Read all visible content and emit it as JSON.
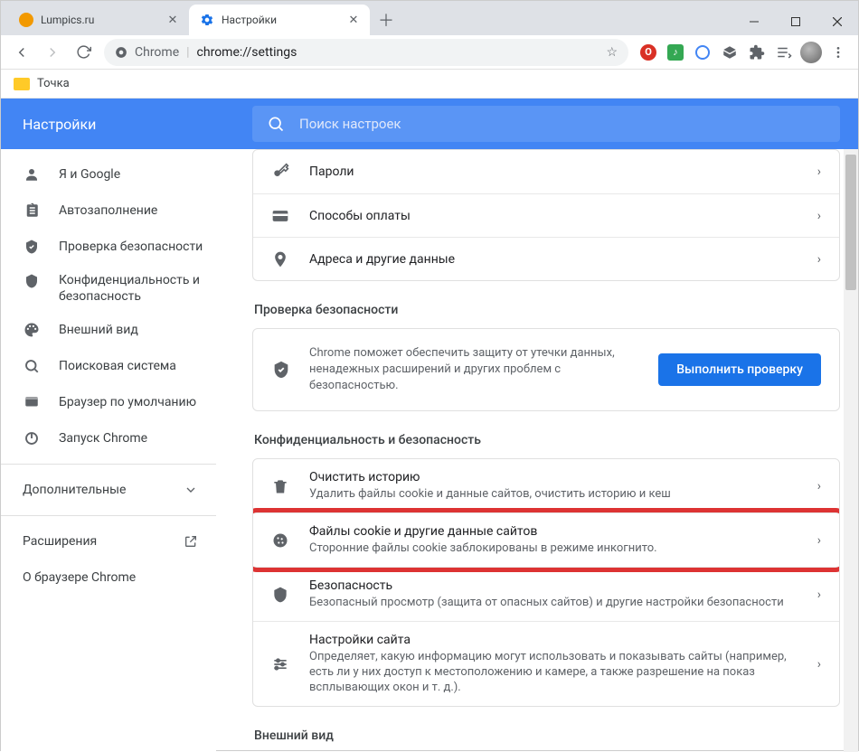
{
  "window": {
    "tabs": [
      {
        "label": "Lumpics.ru",
        "active": false,
        "favicon": "orange"
      },
      {
        "label": "Настройки",
        "active": true,
        "favicon": "gear"
      }
    ]
  },
  "urlbar": {
    "scheme_label": "Chrome",
    "url": "chrome://settings"
  },
  "bookmarks": {
    "items": [
      {
        "label": "Точка"
      }
    ]
  },
  "settings": {
    "title": "Настройки",
    "search_placeholder": "Поиск настроек"
  },
  "sidebar": {
    "items": [
      {
        "id": "you-and-google",
        "label": "Я и Google",
        "icon": "person"
      },
      {
        "id": "autofill",
        "label": "Автозаполнение",
        "icon": "clipboard"
      },
      {
        "id": "safety-check",
        "label": "Проверка безопасности",
        "icon": "shield-check"
      },
      {
        "id": "privacy",
        "label": "Конфиденциальность и безопасность",
        "icon": "shield"
      },
      {
        "id": "appearance",
        "label": "Внешний вид",
        "icon": "palette"
      },
      {
        "id": "search-engine",
        "label": "Поисковая система",
        "icon": "search"
      },
      {
        "id": "default-browser",
        "label": "Браузер по умолчанию",
        "icon": "browser"
      },
      {
        "id": "on-startup",
        "label": "Запуск Chrome",
        "icon": "power"
      }
    ],
    "advanced": "Дополнительные",
    "extensions": "Расширения",
    "about": "О браузере Chrome"
  },
  "content": {
    "autofill_rows": [
      {
        "id": "passwords",
        "label": "Пароли",
        "icon": "key"
      },
      {
        "id": "payments",
        "label": "Способы оплаты",
        "icon": "card"
      },
      {
        "id": "addresses",
        "label": "Адреса и другие данные",
        "icon": "pin"
      }
    ],
    "safety": {
      "title": "Проверка безопасности",
      "text": "Chrome поможет обеспечить защиту от утечки данных, ненадежных расширений и других проблем с безопасностью.",
      "button": "Выполнить проверку"
    },
    "privacy": {
      "title": "Конфиденциальность и безопасность",
      "rows": [
        {
          "id": "clear-data",
          "icon": "trash",
          "title": "Очистить историю",
          "sub": "Удалить файлы cookie и данные сайтов, очистить историю и кеш",
          "highlight": false
        },
        {
          "id": "cookies",
          "icon": "cookie",
          "title": "Файлы cookie и другие данные сайтов",
          "sub": "Сторонние файлы cookie заблокированы в режиме инкогнито.",
          "highlight": true
        },
        {
          "id": "security",
          "icon": "shield",
          "title": "Безопасность",
          "sub": "Безопасный просмотр (защита от опасных сайтов) и другие настройки безопасности",
          "highlight": false
        },
        {
          "id": "site-settings",
          "icon": "sliders",
          "title": "Настройки сайта",
          "sub": "Определяет, какую информацию могут использовать и показывать сайты (например, есть ли у них доступ к местоположению и камере, а также разрешение на показ всплывающих окон и т. д.).",
          "highlight": false
        }
      ]
    },
    "appearance_title": "Внешний вид"
  }
}
